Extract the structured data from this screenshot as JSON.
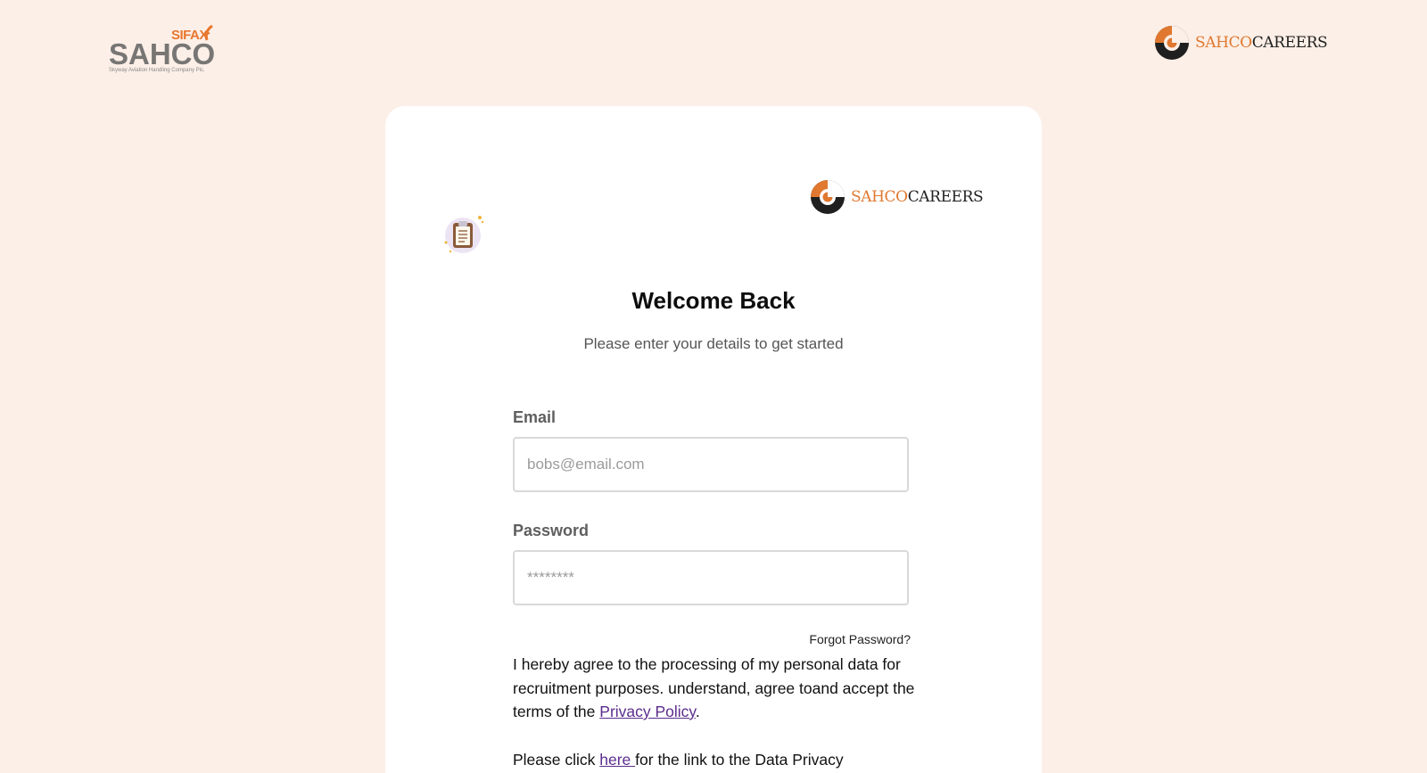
{
  "header": {
    "sahco_logo": {
      "sifax": "SIFAX",
      "name": "SAHCO",
      "tagline": "Skyway Aviation Handling Company Plc."
    },
    "careers_logo": {
      "part1": "SAHCO",
      "part2": "CAREERS"
    }
  },
  "card": {
    "careers_logo": {
      "part1": "SAHCO",
      "part2": "CAREERS"
    },
    "title": "Welcome Back",
    "subtitle": "Please enter your details to get started",
    "email": {
      "label": "Email",
      "placeholder": "bobs@email.com",
      "value": ""
    },
    "password": {
      "label": "Password",
      "placeholder": "********",
      "value": ""
    },
    "forgot_password": "Forgot Password?",
    "consent": {
      "text_before": "I hereby agree to the processing of my personal data for recruitment purposes. understand, agree toand accept the terms of the ",
      "privacy_link": "Privacy Policy",
      "text_after": "."
    },
    "data_privacy": {
      "text_before": "Please click ",
      "here_link": "here ",
      "text_after": "for the link to the Data Privacy"
    }
  },
  "colors": {
    "background": "#fcefe7",
    "accent": "#e0782f",
    "link": "#5b2d8e"
  }
}
